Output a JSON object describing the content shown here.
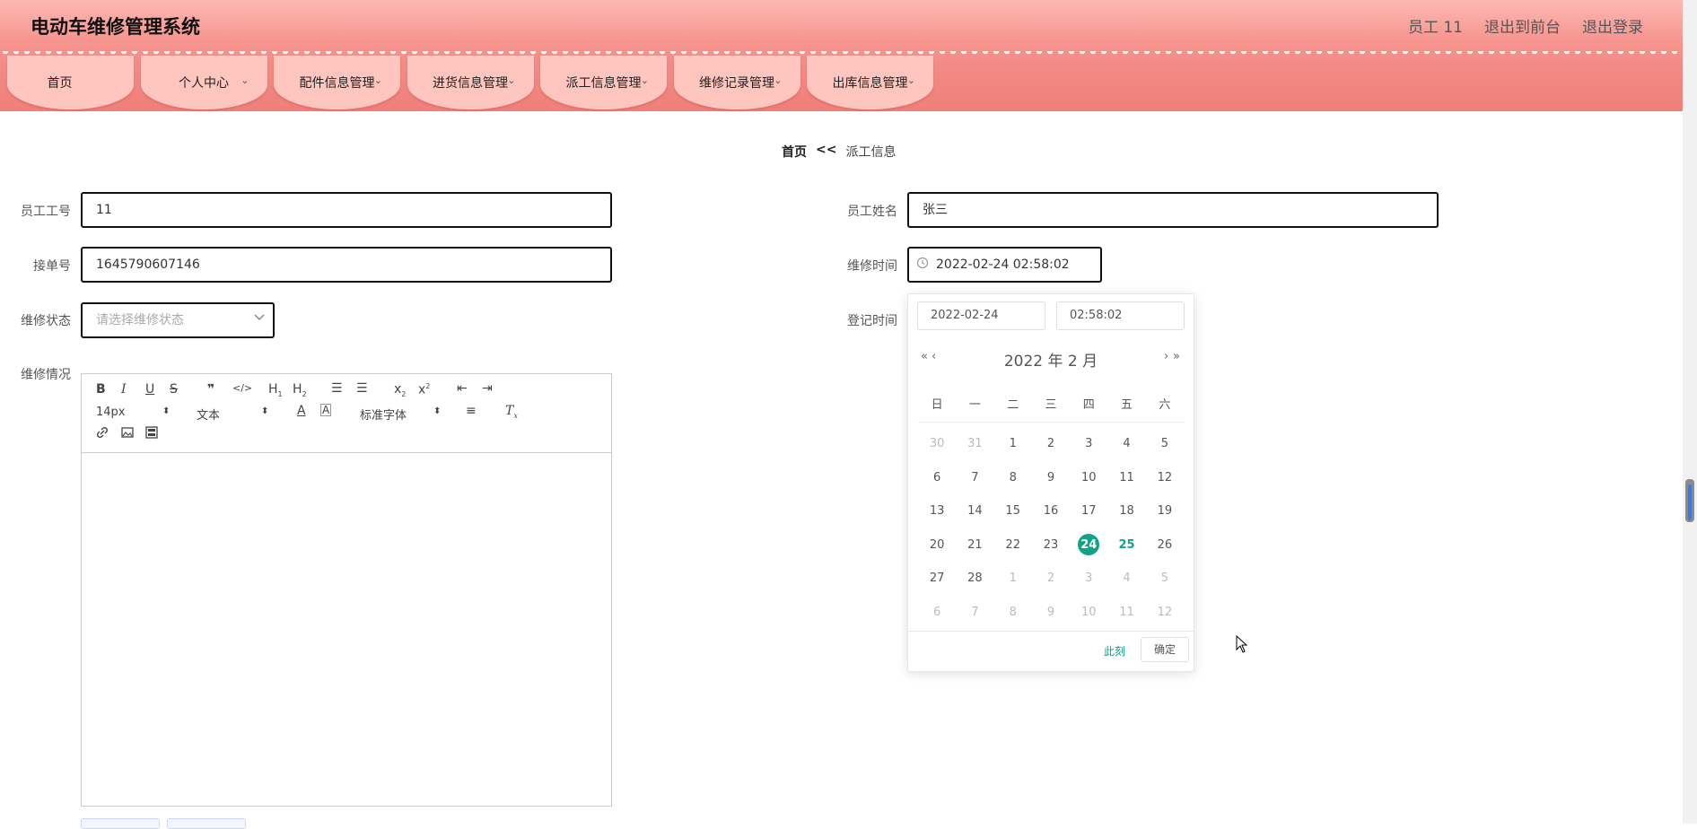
{
  "header": {
    "title": "电动车维修管理系统",
    "user_label": "员工 11",
    "front_link": "退出到前台",
    "logout_link": "退出登录"
  },
  "nav": {
    "items": [
      {
        "label": "首页",
        "has_dropdown": false
      },
      {
        "label": "个人中心",
        "has_dropdown": true
      },
      {
        "label": "配件信息管理",
        "has_dropdown": true
      },
      {
        "label": "进货信息管理",
        "has_dropdown": true
      },
      {
        "label": "派工信息管理",
        "has_dropdown": true
      },
      {
        "label": "维修记录管理",
        "has_dropdown": true
      },
      {
        "label": "出库信息管理",
        "has_dropdown": true
      }
    ]
  },
  "breadcrumb": {
    "home": "首页",
    "separator": "<<",
    "current": "派工信息"
  },
  "form": {
    "employee_id_label": "员工工号",
    "employee_id_value": "11",
    "employee_name_label": "员工姓名",
    "employee_name_value": "张三",
    "order_no_label": "接单号",
    "order_no_value": "1645790607146",
    "repair_time_label": "维修时间",
    "repair_time_value": "2022-02-24 02:58:02",
    "status_label": "维修状态",
    "status_placeholder": "请选择维修状态",
    "register_time_label": "登记时间",
    "repair_detail_label": "维修情况"
  },
  "editor": {
    "font_size": "14px",
    "text_format": "文本",
    "font_family": "标准字体"
  },
  "datepicker": {
    "date_input": "2022-02-24",
    "time_input": "02:58:02",
    "header": "2022 年  2 月",
    "weekdays": [
      "日",
      "一",
      "二",
      "三",
      "四",
      "五",
      "六"
    ],
    "days": [
      {
        "d": "30",
        "m": true
      },
      {
        "d": "31",
        "m": true
      },
      {
        "d": "1"
      },
      {
        "d": "2"
      },
      {
        "d": "3"
      },
      {
        "d": "4"
      },
      {
        "d": "5"
      },
      {
        "d": "6"
      },
      {
        "d": "7"
      },
      {
        "d": "8"
      },
      {
        "d": "9"
      },
      {
        "d": "10"
      },
      {
        "d": "11"
      },
      {
        "d": "12"
      },
      {
        "d": "13"
      },
      {
        "d": "14"
      },
      {
        "d": "15"
      },
      {
        "d": "16"
      },
      {
        "d": "17"
      },
      {
        "d": "18"
      },
      {
        "d": "19"
      },
      {
        "d": "20"
      },
      {
        "d": "21"
      },
      {
        "d": "22"
      },
      {
        "d": "23"
      },
      {
        "d": "24",
        "sel": true
      },
      {
        "d": "25",
        "today": true
      },
      {
        "d": "26"
      },
      {
        "d": "27"
      },
      {
        "d": "28"
      },
      {
        "d": "1",
        "m": true
      },
      {
        "d": "2",
        "m": true
      },
      {
        "d": "3",
        "m": true
      },
      {
        "d": "4",
        "m": true
      },
      {
        "d": "5",
        "m": true
      },
      {
        "d": "6",
        "m": true
      },
      {
        "d": "7",
        "m": true
      },
      {
        "d": "8",
        "m": true
      },
      {
        "d": "9",
        "m": true
      },
      {
        "d": "10",
        "m": true
      },
      {
        "d": "11",
        "m": true
      },
      {
        "d": "12",
        "m": true
      }
    ],
    "now_label": "此刻",
    "confirm_label": "确定"
  },
  "colors": {
    "accent": "#11a388",
    "header_pink": "#f28a85",
    "nav_tab": "#ffc6bf"
  }
}
